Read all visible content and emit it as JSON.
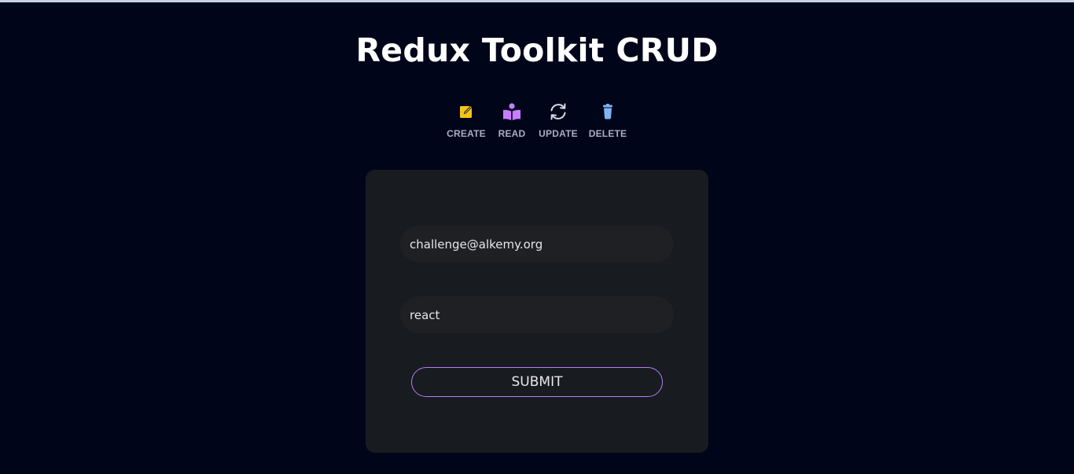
{
  "header": {
    "title": "Redux Toolkit CRUD"
  },
  "nav": {
    "items": [
      {
        "label": "CREATE",
        "icon": "edit-icon",
        "color": "#f5c518"
      },
      {
        "label": "READ",
        "icon": "reader-icon",
        "color": "#c77dff"
      },
      {
        "label": "UPDATE",
        "icon": "refresh-icon",
        "color": "#d6dae2"
      },
      {
        "label": "DELETE",
        "icon": "trash-icon",
        "color": "#7fb3f5"
      }
    ]
  },
  "form": {
    "email_value": "challenge@alkemy.org",
    "password_value": "react",
    "submit_label": "SUBMIT"
  },
  "colors": {
    "background": "#00051a",
    "card": "#181b20",
    "input": "#1f2024",
    "accent": "#b57cf5"
  }
}
